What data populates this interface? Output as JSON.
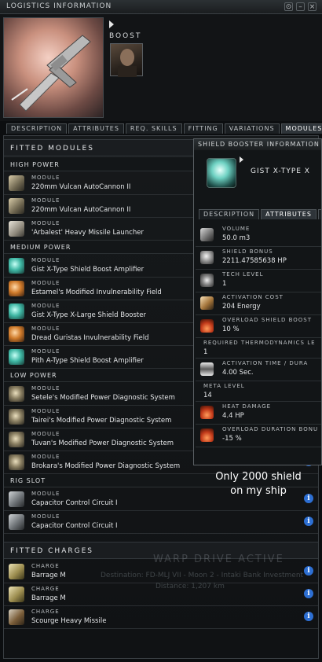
{
  "window": {
    "title": "LOGISTICS INFORMATION",
    "controls": [
      "⊙",
      "–",
      "×"
    ]
  },
  "header": {
    "boost_label": "BOOST"
  },
  "main_tabs": [
    "DESCRIPTION",
    "ATTRIBUTES",
    "REQ. SKILLS",
    "FITTING",
    "VARIATIONS",
    "MODULES"
  ],
  "active_main_tab": "MODULES",
  "fitted_modules": {
    "title": "FITTED MODULES",
    "groups": [
      {
        "name": "HIGH POWER",
        "items": [
          {
            "type": "MODULE",
            "name": "220mm Vulcan AutoCannon II",
            "icon": "autocannon-icon"
          },
          {
            "type": "MODULE",
            "name": "220mm Vulcan AutoCannon II",
            "icon": "autocannon-icon"
          },
          {
            "type": "MODULE",
            "name": "'Arbalest' Heavy Missile Launcher",
            "icon": "missile-launcher-icon"
          }
        ]
      },
      {
        "name": "MEDIUM POWER",
        "items": [
          {
            "type": "MODULE",
            "name": "Gist X-Type Shield Boost Amplifier",
            "icon": "shield-amplifier-icon"
          },
          {
            "type": "MODULE",
            "name": "Estamel's Modified Invulnerability Field",
            "icon": "invulnerability-field-icon"
          },
          {
            "type": "MODULE",
            "name": "Gist X-Type X-Large Shield Booster",
            "icon": "shield-booster-icon"
          },
          {
            "type": "MODULE",
            "name": "Dread Guristas Invulnerability Field",
            "icon": "invulnerability-field-icon"
          },
          {
            "type": "MODULE",
            "name": "Pith A-Type Shield Boost Amplifier",
            "icon": "shield-amplifier-icon"
          }
        ]
      },
      {
        "name": "LOW POWER",
        "items": [
          {
            "type": "MODULE",
            "name": "Setele's Modified Power Diagnostic System",
            "icon": "power-diagnostic-icon"
          },
          {
            "type": "MODULE",
            "name": "Tairei's Modified Power Diagnostic System",
            "icon": "power-diagnostic-icon"
          },
          {
            "type": "MODULE",
            "name": "Tuvan's Modified Power Diagnostic System",
            "icon": "power-diagnostic-icon"
          },
          {
            "type": "MODULE",
            "name": "Brokara's Modified Power Diagnostic System",
            "icon": "power-diagnostic-icon"
          }
        ]
      },
      {
        "name": "RIG SLOT",
        "items": [
          {
            "type": "MODULE",
            "name": "Capacitor Control Circuit I",
            "icon": "rig-icon"
          },
          {
            "type": "MODULE",
            "name": "Capacitor Control Circuit I",
            "icon": "rig-icon"
          }
        ]
      }
    ]
  },
  "fitted_charges": {
    "title": "FITTED CHARGES",
    "items": [
      {
        "type": "CHARGE",
        "name": "Barrage M",
        "icon": "ammo-icon"
      },
      {
        "type": "CHARGE",
        "name": "Barrage M",
        "icon": "ammo-icon"
      },
      {
        "type": "CHARGE",
        "name": "Scourge Heavy Missile",
        "icon": "missile-icon"
      }
    ]
  },
  "info_button_glyph": "i",
  "popup": {
    "title": "SHIELD BOOSTER INFORMATION",
    "item_name": "GIST X-TYPE X",
    "tabs": [
      "DESCRIPTION",
      "ATTRIBUTES",
      "REQ"
    ],
    "active_tab": "ATTRIBUTES",
    "attributes": [
      {
        "label": "VOLUME",
        "value": "50.0 m3",
        "icon": "volume-icon"
      },
      {
        "label": "SHIELD BONUS",
        "value": "2211.47585638 HP",
        "icon": "shield-bonus-icon"
      },
      {
        "label": "TECH LEVEL",
        "value": "1",
        "icon": "tech-level-icon"
      },
      {
        "label": "ACTIVATION COST",
        "value": "204 Energy",
        "icon": "activation-cost-icon"
      },
      {
        "label": "OVERLOAD SHIELD BOOST",
        "value": "10 %",
        "icon": "overload-icon"
      },
      {
        "label": "REQUIRED THERMODYNAMICS LE",
        "value": "1",
        "icon": ""
      },
      {
        "label": "ACTIVATION TIME / DURA",
        "value": "4.00 Sec.",
        "icon": "hourglass-icon"
      },
      {
        "label": "META LEVEL",
        "value": "14",
        "icon": ""
      },
      {
        "label": "HEAT DAMAGE",
        "value": "4.4 HP",
        "icon": "heat-damage-icon"
      },
      {
        "label": "OVERLOAD DURATION BONU",
        "value": "-15 %",
        "icon": "overload-duration-icon"
      }
    ]
  },
  "annotation": {
    "line1": "Only 2000 shield",
    "line2": "on my ship"
  },
  "background_overlay": {
    "warp": "WARP DRIVE ACTIVE",
    "destination": "Destination: FD-MLJ VII - Moon 2 - Intaki Bank Investment",
    "distance": "Distance: 1,207 km"
  }
}
